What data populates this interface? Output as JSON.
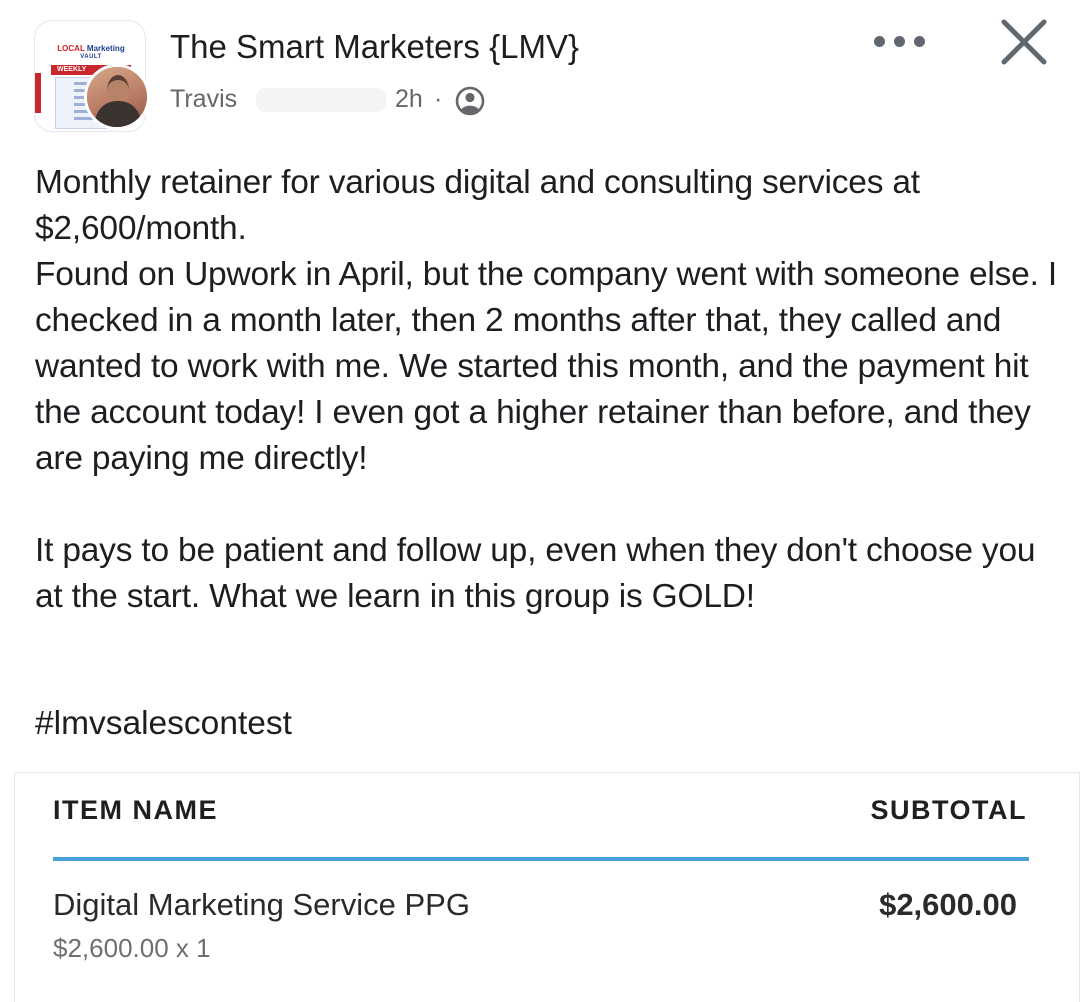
{
  "header": {
    "group_name": "The Smart Marketers {LMV}",
    "author": "Travis",
    "time": "2h",
    "separator": "·",
    "audience_icon": "members-icon",
    "more_icon": "more-horizontal-icon",
    "close_icon": "close-icon",
    "group_avatar": {
      "logo_line1_red": "LOCAL",
      "logo_line1_blue": "Marketing",
      "logo_line2": "VAULT",
      "ribbon": "WEEKLY"
    }
  },
  "post": {
    "paragraphs": [
      "Monthly retainer for various digital and consulting services at $2,600/month.\nFound on Upwork in April, but the company went with someone else.  I checked in a month later,  then 2 months after that, they called and wanted to work with me.  We started this month, and the payment hit the account today! I even got a higher retainer than before, and they are paying me directly!",
      "It pays to be patient and follow up, even when they don't choose you at the start.  What we learn in this group is GOLD!"
    ],
    "hashtag": "#lmvsalescontest"
  },
  "invoice": {
    "col_item": "ITEM NAME",
    "col_subtotal": "SUBTOTAL",
    "item_name": "Digital Marketing Service PPG",
    "item_subtotal": "$2,600.00",
    "item_qty": "$2,600.00 x 1",
    "accent_color": "#4a9fd8"
  }
}
